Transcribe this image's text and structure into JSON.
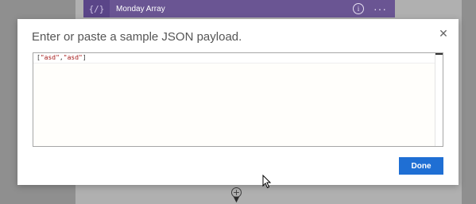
{
  "background": {
    "card": {
      "icon_glyph": "{/}",
      "title": "Monday Array",
      "info_glyph": "i",
      "more_glyph": "···"
    },
    "add_glyph": "+",
    "arrow_glyph": "▼"
  },
  "dialog": {
    "title": "Enter or paste a sample JSON payload.",
    "close_glyph": "✕",
    "editor": {
      "open": "[",
      "str1": "\"asd\"",
      "comma": ",",
      "str2": "\"asd\"",
      "close": "]"
    },
    "done_label": "Done"
  },
  "colors": {
    "accent": "#1f6fd4",
    "card": "#6a5593",
    "string": "#a31515"
  }
}
